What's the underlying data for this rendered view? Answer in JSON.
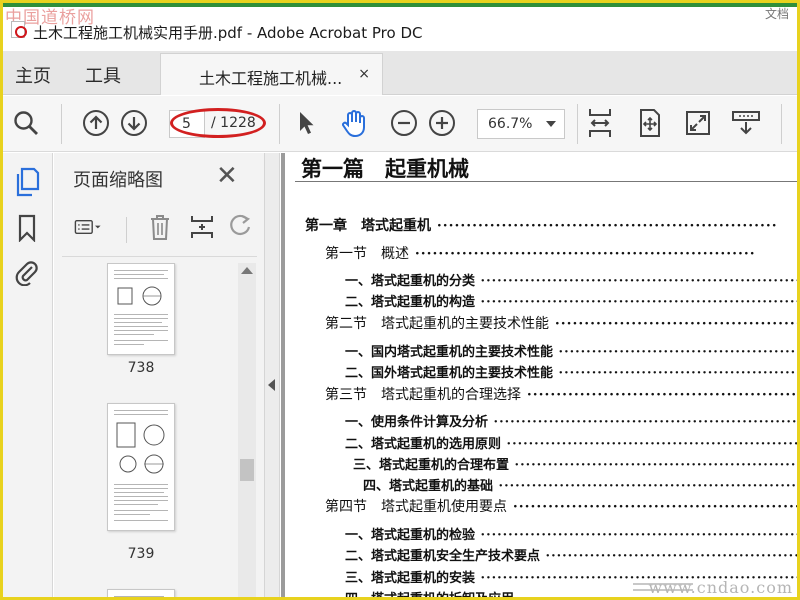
{
  "window": {
    "watermark_top": "中国道桥网",
    "title": "土木工程施工机械实用手册.pdf - Adobe Acrobat Pro DC",
    "corner_text": "文档"
  },
  "menubar": {
    "home": "主页",
    "tools": "工具",
    "doc_tab_label": "土木工程施工机械...",
    "doc_tab_close": "×"
  },
  "toolbar": {
    "page_current": "5",
    "page_total": "/ 1228",
    "zoom": "66.7%"
  },
  "panel": {
    "title": "页面缩略图",
    "close": "✕",
    "thumbnails": [
      {
        "page": "738"
      },
      {
        "page": "739"
      }
    ]
  },
  "document": {
    "part_title": "第一篇　起重机械",
    "toc": [
      {
        "level": 1,
        "text": "第一章　塔式起重机"
      },
      {
        "level": 2,
        "text": "第一节　概述"
      },
      {
        "level": 3,
        "text": "一、塔式起重机的分类"
      },
      {
        "level": 3,
        "text": "二、塔式起重机的构造"
      },
      {
        "level": 2,
        "text": "第二节　塔式起重机的主要技术性能"
      },
      {
        "level": 3,
        "text": "一、国内塔式起重机的主要技术性能"
      },
      {
        "level": 3,
        "text": "二、国外塔式起重机的主要技术性能"
      },
      {
        "level": 2,
        "text": "第三节　塔式起重机的合理选择"
      },
      {
        "level": 3,
        "text": "一、使用条件计算及分析"
      },
      {
        "level": 3,
        "text": "二、塔式起重机的选用原则"
      },
      {
        "level": 3,
        "text": "三、塔式起重机的合理布置"
      },
      {
        "level": 3,
        "text": "四、塔式起重机的基础"
      },
      {
        "level": 2,
        "text": "第四节　塔式起重机使用要点"
      },
      {
        "level": 3,
        "text": "一、塔式起重机的检验"
      },
      {
        "level": 3,
        "text": "二、塔式起重机安全生产技术要点"
      },
      {
        "level": 3,
        "text": "三、塔式起重机的安装"
      },
      {
        "level": 3,
        "text": "四、塔式起重机的拆卸及应用"
      }
    ],
    "watermark": "www.cndao.com"
  },
  "colors": {
    "annotation_red": "#d22020",
    "border_yellow": "#e8d21e",
    "top_green": "#2f8f3a",
    "accent_blue": "#2a6fdb"
  }
}
